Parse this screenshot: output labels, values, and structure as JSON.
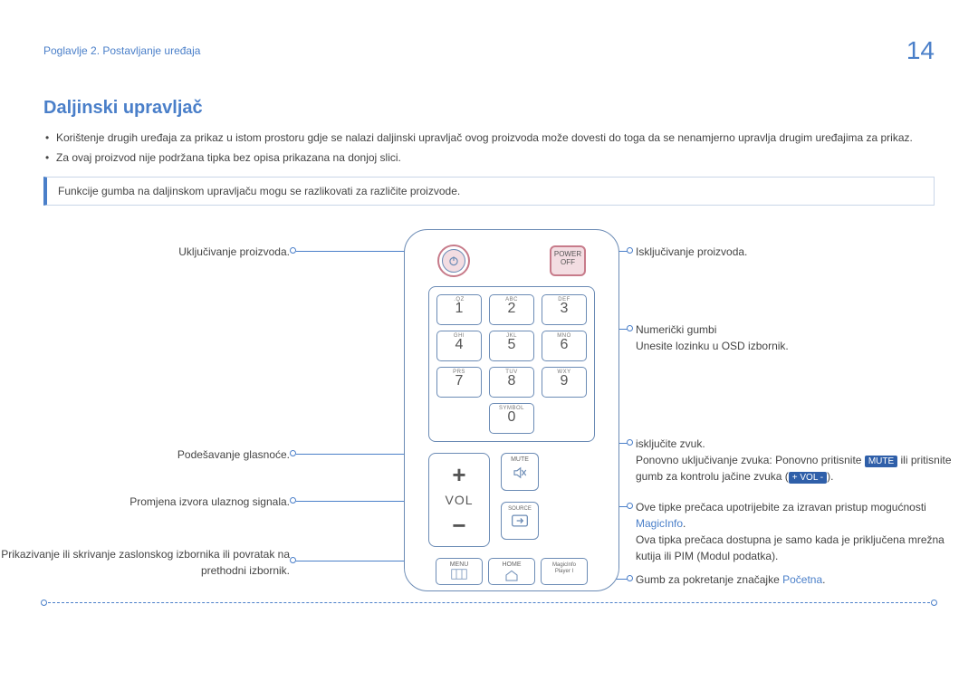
{
  "header": {
    "chapter": "Poglavlje 2. Postavljanje uređaja",
    "page": "14"
  },
  "title": "Daljinski upravljač",
  "bullets": [
    "Korištenje drugih uređaja za prikaz u istom prostoru gdje se nalazi daljinski upravljač ovog proizvoda može dovesti do toga da se nenamjerno upravlja drugim uređajima za prikaz.",
    "Za ovaj proizvod nije podržana tipka bez opisa prikazana na donjoj slici."
  ],
  "note": "Funkcije gumba na daljinskom upravljaču mogu se razlikovati za različite proizvode.",
  "remote": {
    "power_off_l1": "POWER",
    "power_off_l2": "OFF",
    "keys": {
      "r1": [
        {
          "mini": ".QZ",
          "num": "1"
        },
        {
          "mini": "ABC",
          "num": "2"
        },
        {
          "mini": "DEF",
          "num": "3"
        }
      ],
      "r2": [
        {
          "mini": "GHI",
          "num": "4"
        },
        {
          "mini": "JKL",
          "num": "5"
        },
        {
          "mini": "MNO",
          "num": "6"
        }
      ],
      "r3": [
        {
          "mini": "PRS",
          "num": "7"
        },
        {
          "mini": "TUV",
          "num": "8"
        },
        {
          "mini": "WXY",
          "num": "9"
        }
      ],
      "r4": {
        "mini": "SYMBOL",
        "num": "0"
      }
    },
    "vol": {
      "plus": "+",
      "label": "VOL",
      "minus": "−"
    },
    "mute": "MUTE",
    "source": "SOURCE",
    "menu": "MENU",
    "home": "HOME",
    "magicinfo_l1": "MagicInfo",
    "magicinfo_l2": "Player I"
  },
  "labels": {
    "left": {
      "power": "Uključivanje proizvoda.",
      "vol": "Podešavanje glasnoće.",
      "source": "Promjena izvora ulaznog signala.",
      "menu": "Prikazivanje ili skrivanje zaslonskog izbornika ili povratak na prethodni izbornik."
    },
    "right": {
      "poweroff": "Isključivanje proizvoda.",
      "numeric_l1": "Numerički gumbi",
      "numeric_l2": "Unesite lozinku u OSD izbornik.",
      "mute_l1": "isključite zvuk.",
      "mute_l2a": "Ponovno uključivanje zvuka: Ponovno pritisnite ",
      "mute_tag": "MUTE",
      "mute_l2b": " ili pritisnite gumb za kontrolu jačine zvuka (",
      "vol_tag": "+ VOL -",
      "mute_l2c": ").",
      "magicinfo_l1": "Ove tipke prečaca upotrijebite za izravan pristup mogućnosti ",
      "magicinfo_link": "MagicInfo",
      "magicinfo_l1b": ".",
      "magicinfo_l2": "Ova tipka prečaca dostupna je samo kada je priključena mrežna kutija ili PIM (Modul podatka).",
      "home_a": "Gumb za pokretanje značajke ",
      "home_link": "Početna",
      "home_b": "."
    }
  }
}
